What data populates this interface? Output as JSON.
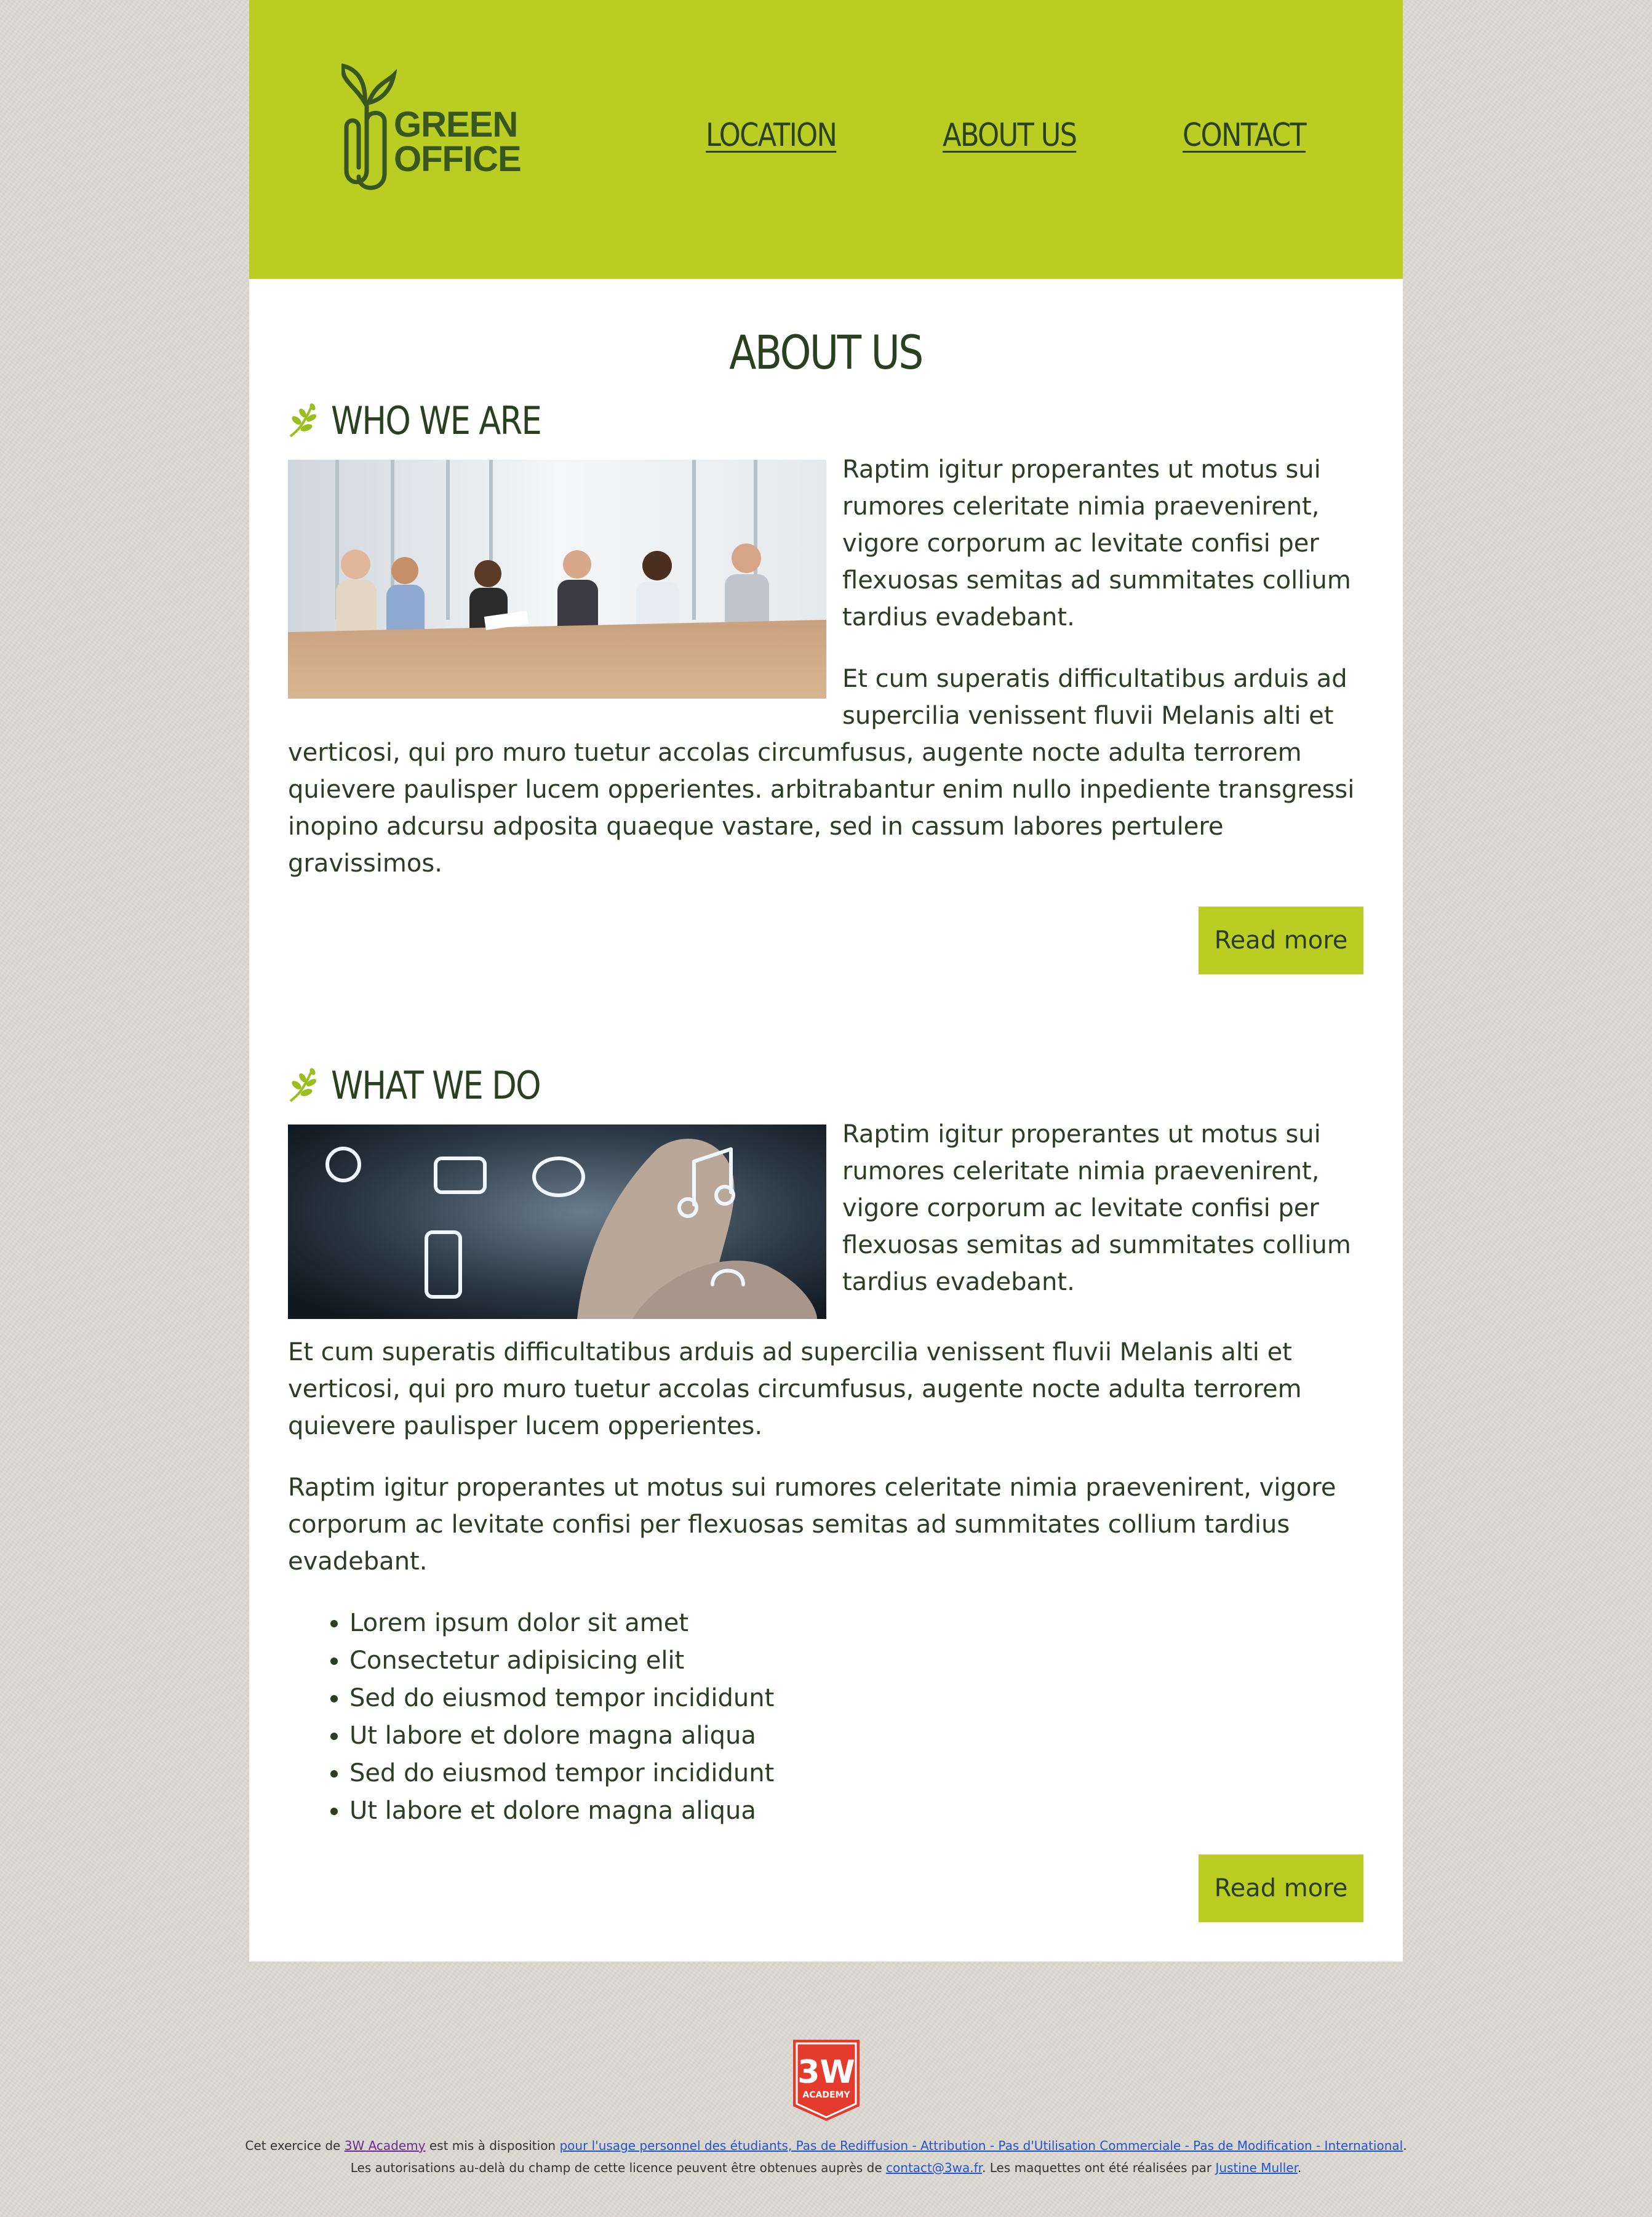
{
  "header": {
    "logo": {
      "line1": "GREEN",
      "line2": "OFFICE"
    },
    "nav": [
      {
        "label": "LOCATION"
      },
      {
        "label": "ABOUT US"
      },
      {
        "label": "CONTACT"
      }
    ]
  },
  "main": {
    "title": "ABOUT US",
    "sections": [
      {
        "heading": "WHO WE ARE",
        "paragraphs": [
          "Raptim igitur properantes ut motus sui rumores celeritate nimia praevenirent, vigore corporum ac levitate confisi per flexuosas semitas ad summitates collium tardius evadebant.",
          "Et cum superatis difficultatibus arduis ad supercilia venissent fluvii Melanis alti et verticosi, qui pro muro tuetur accolas circumfusus, augente nocte adulta terrorem quievere paulisper lucem opperientes. arbitrabantur enim nullo inpediente transgressi inopino adcursu adposita quaeque vastare, sed in cassum labores pertulere gravissimos."
        ],
        "button": "Read more"
      },
      {
        "heading": "WHAT WE DO",
        "paragraphs": [
          "Raptim igitur properantes ut motus sui rumores celeritate nimia praevenirent, vigore corporum ac levitate confisi per flexuosas semitas ad summitates collium tardius evadebant.",
          "Et cum superatis difficultatibus arduis ad supercilia venissent fluvii Melanis alti et verticosi, qui pro muro tuetur accolas circumfusus, augente nocte adulta terrorem quievere paulisper lucem opperientes.",
          "Raptim igitur properantes ut motus sui rumores celeritate nimia praevenirent, vigore corporum ac levitate confisi per flexuosas semitas ad summitates collium tardius evadebant."
        ],
        "list": [
          "Lorem ipsum dolor sit amet",
          "Consectetur adipisicing elit",
          "Sed do eiusmod tempor incididunt",
          "Ut labore et dolore magna aliqua",
          "Sed do eiusmod tempor incididunt",
          "Ut labore et dolore magna aliqua"
        ],
        "button": "Read more"
      }
    ]
  },
  "footer": {
    "badge": {
      "line1": "3W",
      "line2": "ACADEMY"
    },
    "line1": {
      "t1": "Cet exercice de ",
      "link1": "3W Academy",
      "t2": " est mis à disposition ",
      "link2": "pour l'usage personnel des étudiants, Pas de Rediffusion - Attribution - Pas d'Utilisation Commerciale - Pas de Modification - International",
      "t3": "."
    },
    "line2": {
      "t1": "Les autorisations au-delà du champ de cette licence peuvent être obtenues auprès de ",
      "link1": "contact@3wa.fr",
      "t2": ". Les maquettes ont été réalisées par ",
      "link2": "Justine Muller",
      "t3": "."
    }
  },
  "colors": {
    "accent": "#bacd22",
    "text": "#2b3d22",
    "background": "#dcd8d1",
    "badge": "#e53b2c"
  }
}
